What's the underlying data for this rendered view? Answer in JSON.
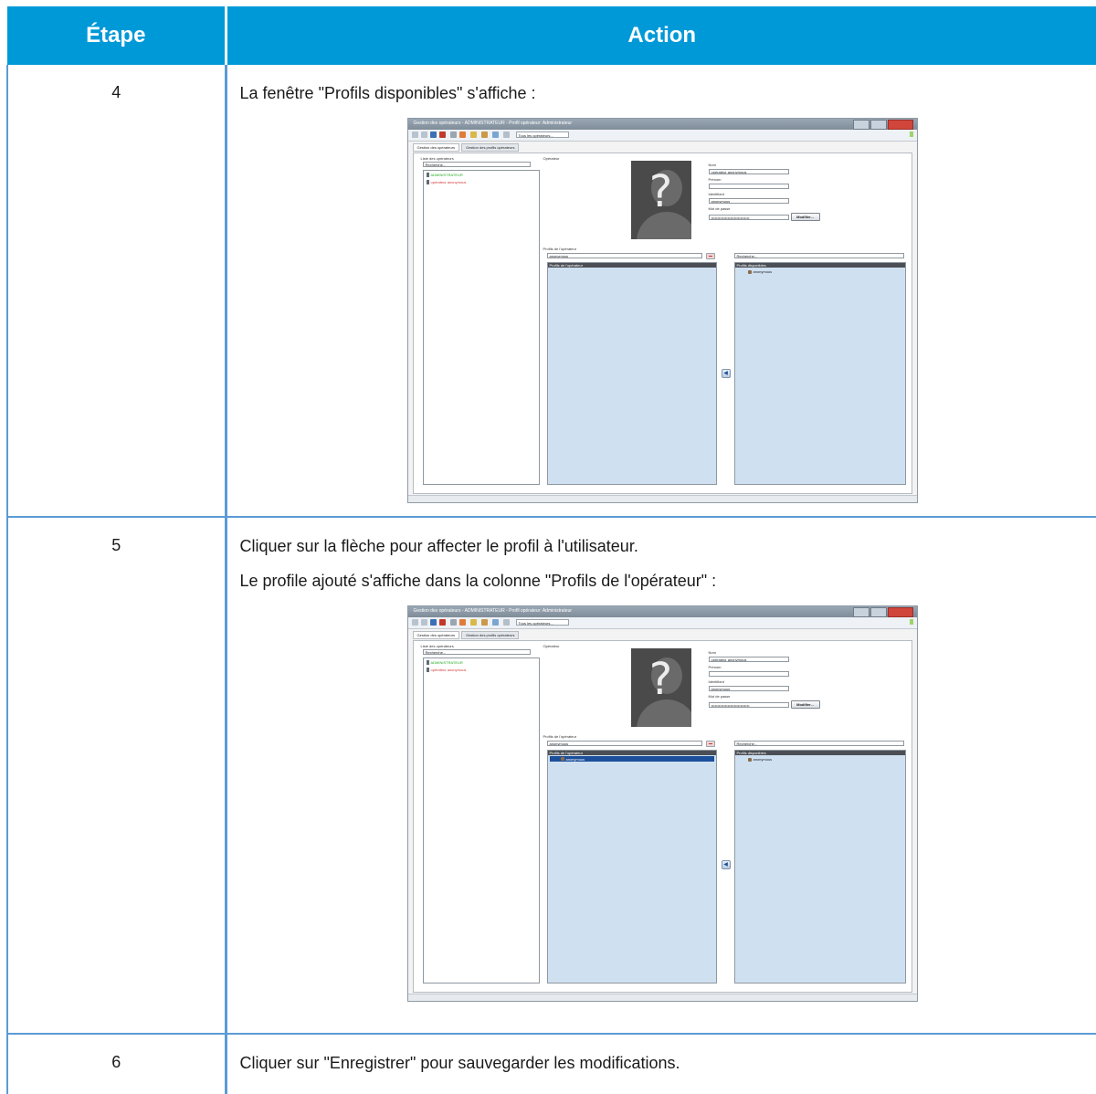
{
  "table": {
    "headers": {
      "step": "Étape",
      "action": "Action"
    },
    "rows": [
      {
        "step": "4",
        "lines": [
          "La fenêtre \"Profils disponibles\" s'affiche :"
        ]
      },
      {
        "step": "5",
        "lines": [
          "Cliquer sur la flèche pour affecter le profil à l'utilisateur.",
          "Le profile ajouté s'affiche dans la colonne \"Profils de l'opérateur\" :"
        ]
      },
      {
        "step": "6",
        "lines": [
          "Cliquer sur \"Enregistrer\" pour sauvegarder les modifications."
        ]
      }
    ]
  },
  "window": {
    "title": "Gestion des opérateurs - ADMINISTRATEUR - Profil opérateur: Administrateur",
    "toolbar_select": "Tous les opérateurs...",
    "tabs": [
      "Gestion des opérateurs",
      "Gestion des profils opérateurs"
    ],
    "operators_list_label": "Liste des opérateurs",
    "search_placeholder": "Recherche...",
    "operators": [
      {
        "name": "ADMINISTRATEUR",
        "color": "#22aa22"
      },
      {
        "name": "opérateur anonymous",
        "color": "#d43a3a"
      }
    ],
    "operator_label": "Opérateur",
    "fields": {
      "nom_label": "Nom",
      "nom_value": "opérateur anonymous",
      "prenom_label": "Prénom",
      "prenom_value": "",
      "identifiant_label": "Identifiant",
      "identifiant_value": "anonymous",
      "password_label": "Mot de passe",
      "password_value": "••••••••••••••••••••••••••••••",
      "modify_button": "Modifier..."
    },
    "profiles_label": "Profils de l'opérateur",
    "profile_filter_value": "anonymous",
    "operator_profiles_header": "Profils de l'opérateur",
    "available_search": "Recherche...",
    "available_profiles_header": "Profils disponibles",
    "available_profile_item": "anonymous",
    "assigned_profile_item": "anonymous",
    "arrow_glyph": "◀"
  }
}
